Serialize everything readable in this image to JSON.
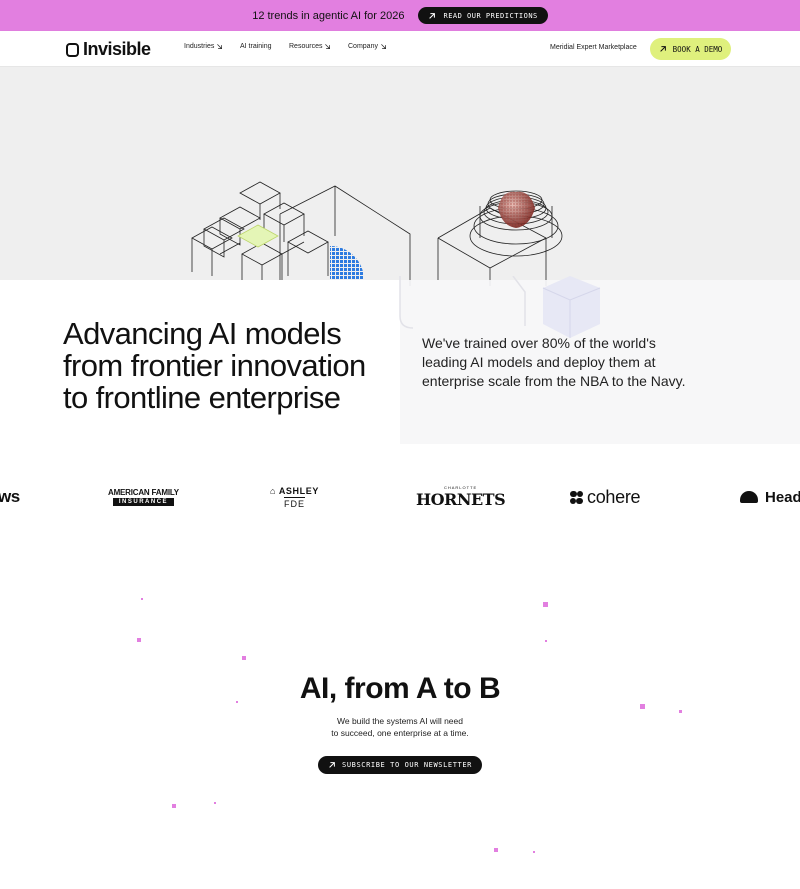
{
  "announcement": {
    "text": "12 trends in agentic AI for 2026",
    "cta_label": "READ OUR PREDICTIONS"
  },
  "nav": {
    "logo_text": "Invisible",
    "links": [
      "Industries",
      "AI training",
      "Resources",
      "Company"
    ],
    "marketplace_label": "Meridial Expert Marketplace",
    "demo_label": "BOOK A DEMO"
  },
  "hero": {
    "title_lines": [
      "Advancing AI models",
      "from frontier innovation",
      "to frontline enterprise"
    ],
    "subtitle": "We've trained over 80% of the world's leading AI models and deploy them at enterprise scale from the NBA to the Navy."
  },
  "logos": {
    "aws": "ws",
    "amfam_line1": "AMERICAN FAMILY",
    "amfam_line2": "INSURANCE",
    "ashley_line1": "ASHLEY",
    "ashley_line2": "FDE",
    "hornets_line1": "CHARLOTTE",
    "hornets_line2": "HORNETS",
    "cohere": "cohere",
    "head": "Head"
  },
  "section_atob": {
    "title": "AI, from A to B",
    "subtitle_lines": [
      "We build the systems AI will need",
      "to succeed, one enterprise at a time."
    ],
    "cta_label": "SUBSCRIBE TO OUR NEWSLETTER"
  },
  "colors": {
    "announcement_bg": "#e27fe0",
    "demo_button_bg": "#dff07d",
    "hero_bg": "#efefef",
    "accent_blue": "#2d7be0"
  }
}
